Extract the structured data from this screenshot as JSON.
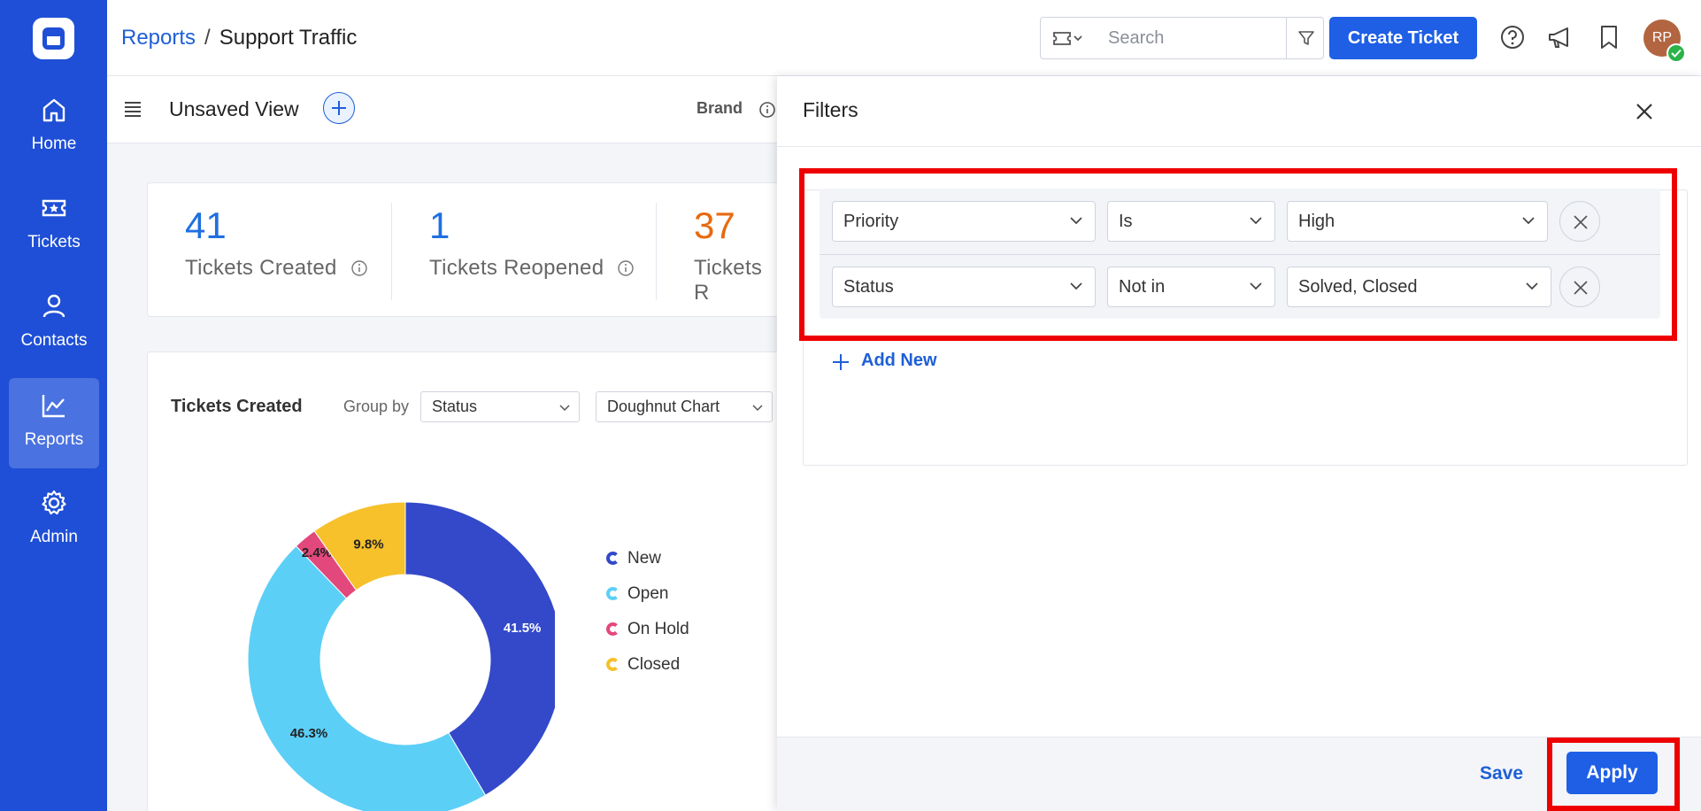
{
  "sidebar": {
    "items": [
      {
        "label": "Home",
        "icon": "home-icon"
      },
      {
        "label": "Tickets",
        "icon": "ticket-icon"
      },
      {
        "label": "Contacts",
        "icon": "user-icon"
      },
      {
        "label": "Reports",
        "icon": "chart-line-icon",
        "active": true
      },
      {
        "label": "Admin",
        "icon": "gear-icon"
      }
    ]
  },
  "header": {
    "breadcrumb_root": "Reports",
    "breadcrumb_sep": "/",
    "breadcrumb_current": "Support Traffic",
    "search_placeholder": "Search",
    "create_label": "Create Ticket",
    "avatar_initials": "RP"
  },
  "subheader": {
    "view_title": "Unsaved View",
    "brand_label": "Brand"
  },
  "stats": [
    {
      "value": "41",
      "label": "Tickets Created",
      "color": "#1f6fe0"
    },
    {
      "value": "1",
      "label": "Tickets Reopened",
      "color": "#1f6fe0"
    },
    {
      "value": "37",
      "label": "Tickets R",
      "color": "#e86a10"
    }
  ],
  "chart_card": {
    "title": "Tickets Created",
    "groupby_label": "Group by",
    "groupby_value": "Status",
    "chart_type_value": "Doughnut Chart"
  },
  "chart_data": {
    "type": "pie",
    "variant": "doughnut",
    "categories": [
      "New",
      "Open",
      "On Hold",
      "Closed"
    ],
    "values": [
      41.5,
      46.3,
      2.4,
      9.8
    ],
    "labels": [
      "41.5%",
      "46.3%",
      "2.4%",
      "9.8%"
    ],
    "colors": [
      "#3449c9",
      "#5ccff7",
      "#e2487b",
      "#f6c12a"
    ],
    "legend": "right"
  },
  "filters": {
    "title": "Filters",
    "rows": [
      {
        "field": "Priority",
        "operator": "Is",
        "value": "High"
      },
      {
        "field": "Status",
        "operator": "Not in",
        "value": "Solved, Closed"
      }
    ],
    "add_new_label": "Add New",
    "save_label": "Save",
    "apply_label": "Apply"
  }
}
